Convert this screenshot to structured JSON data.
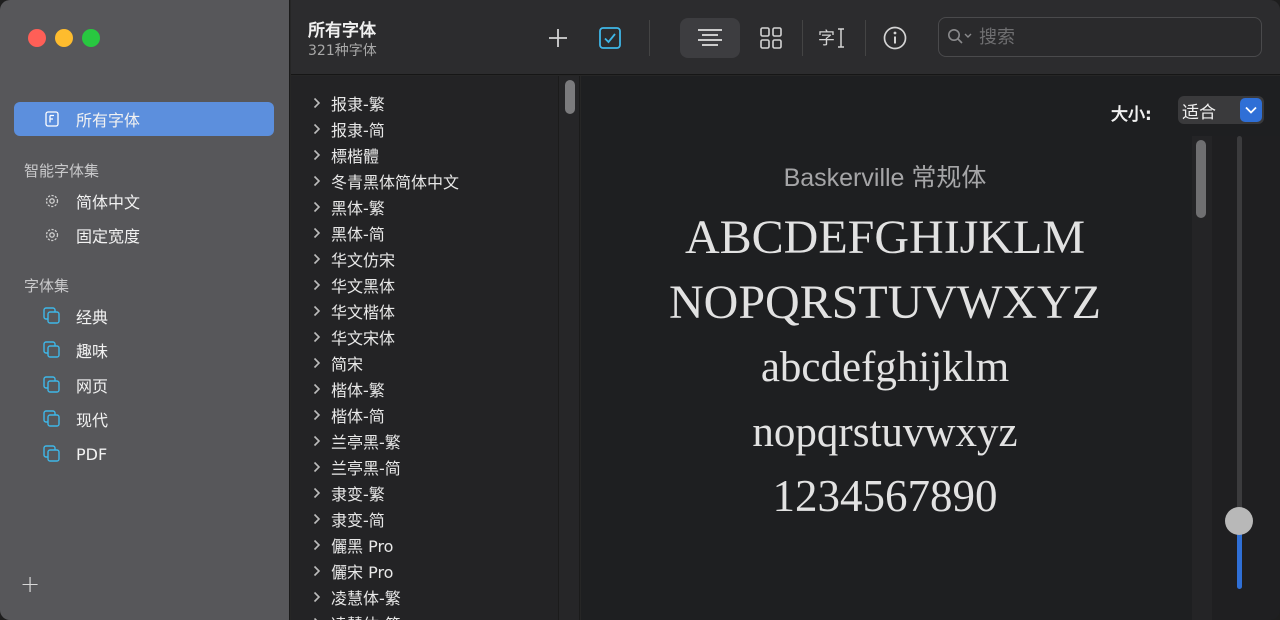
{
  "sidebar": {
    "all_fonts": "所有字体",
    "smart_header": "智能字体集",
    "smart_items": [
      "简体中文",
      "固定宽度"
    ],
    "collections_header": "字体集",
    "collections": [
      "经典",
      "趣味",
      "网页",
      "现代",
      "PDF"
    ],
    "add_symbol": "+"
  },
  "toolbar": {
    "title": "所有字体",
    "subtitle": "321种字体",
    "search_placeholder": "搜索"
  },
  "font_list": [
    "报隶-繁",
    "报隶-简",
    "標楷體",
    "冬青黑体简体中文",
    "黑体-繁",
    "黑体-简",
    "华文仿宋",
    "华文黑体",
    "华文楷体",
    "华文宋体",
    "简宋",
    "楷体-繁",
    "楷体-简",
    "兰亭黑-繁",
    "兰亭黑-简",
    "隶变-繁",
    "隶变-简",
    "儷黑 Pro",
    "儷宋 Pro",
    "凌慧体-繁",
    "凌慧体-简"
  ],
  "preview": {
    "size_label": "大小:",
    "size_value": "适合",
    "font_name": "Baskerville 常规体",
    "lines": [
      "ABCDEFGHIJKLM",
      "NOPQRSTUVWXYZ",
      "abcdefghijklm",
      "nopqrstuvwxyz",
      "1234567890"
    ]
  },
  "size_slider_level": 0.15,
  "colors": {
    "accent": "#2f6fd6",
    "selection": "#5c8fdd",
    "collection_icon": "#3fb7e8"
  }
}
